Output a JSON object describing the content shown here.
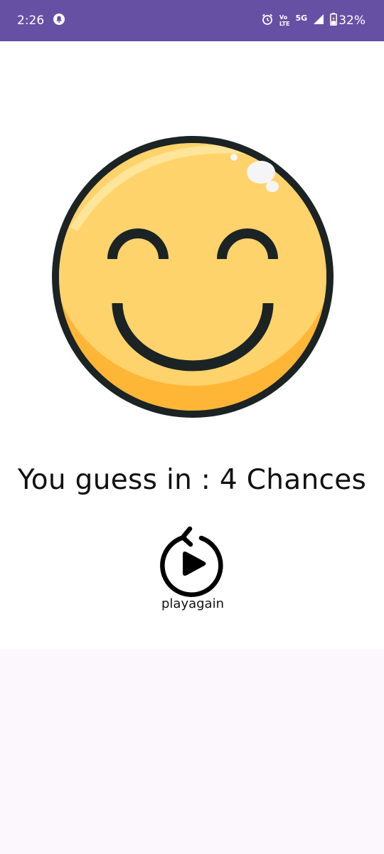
{
  "status_bar": {
    "time": "2:26",
    "net_top": "Vo",
    "net_bottom": "LTE",
    "network": "5G",
    "battery": "32%",
    "icons": [
      "notification-icon",
      "alarm-icon",
      "wifi-calling-icon",
      "signal-icon",
      "battery-icon"
    ]
  },
  "main": {
    "emoji": "smiling-face",
    "result_text": "You guess in : 4 Chances",
    "play_again_label": "playagain",
    "play_again_icon": "replay-play-icon"
  },
  "colors": {
    "status_bar": "#6650a4",
    "face_fill": "#ffd36b",
    "face_shadow": "#ffb637",
    "face_outline": "#1b2324",
    "bottom_area": "#fcf7fd"
  }
}
